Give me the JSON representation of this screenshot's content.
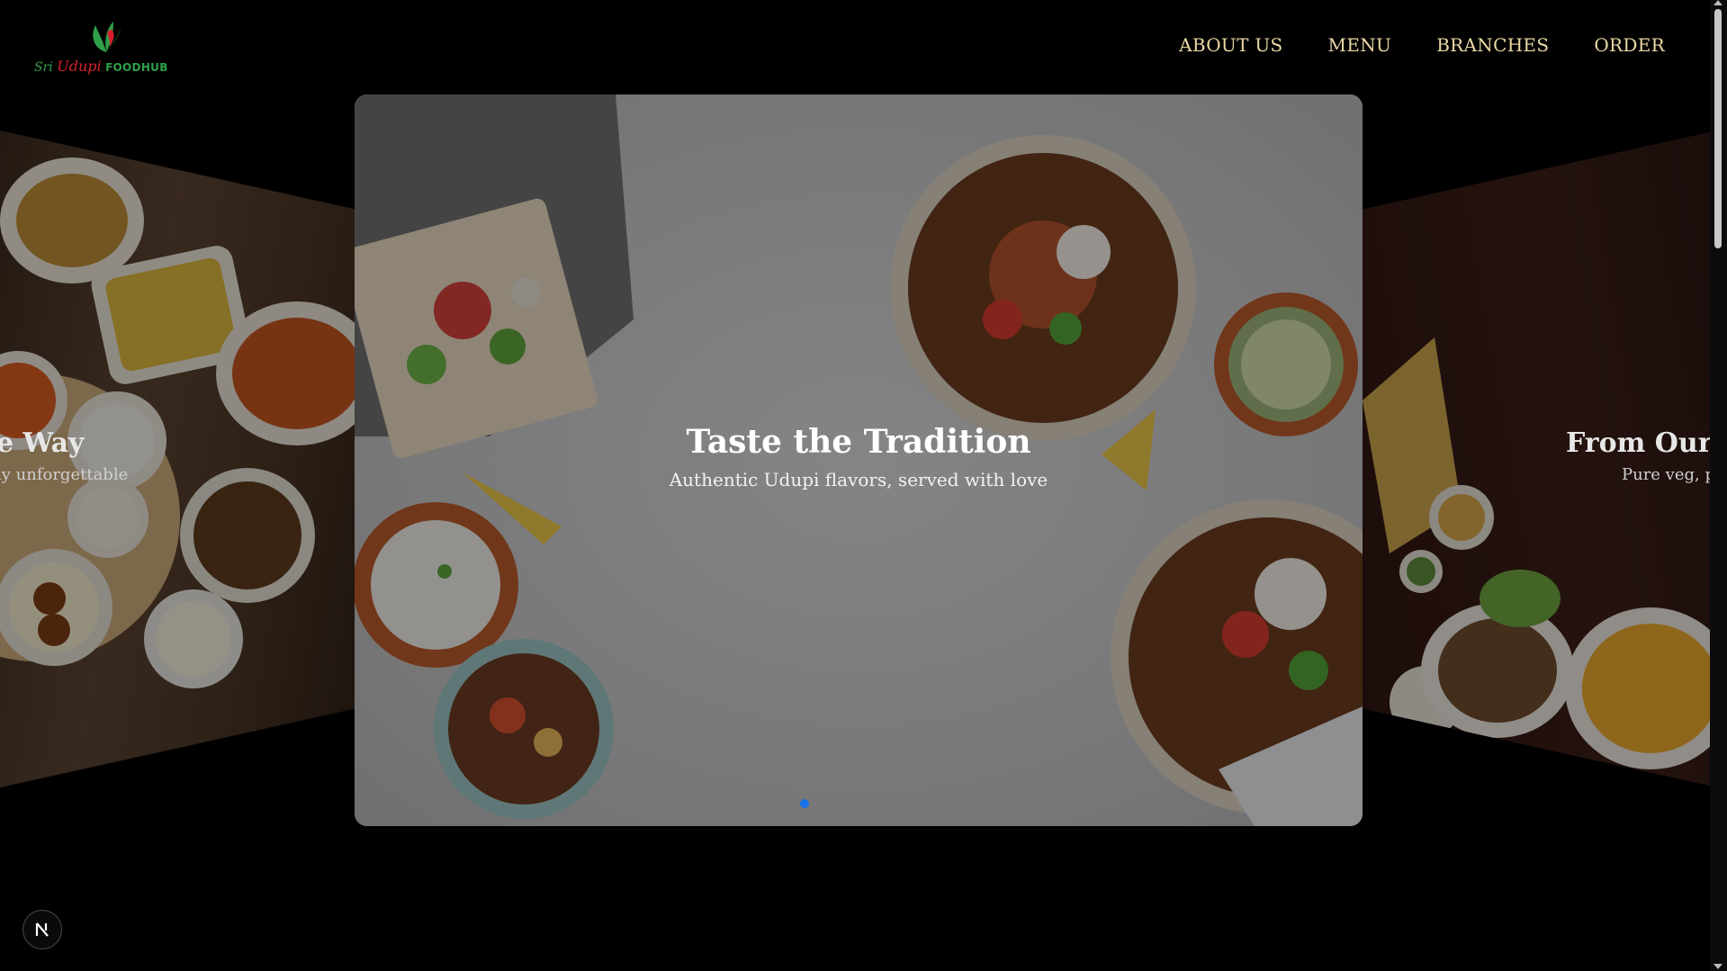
{
  "brand": {
    "logo_sri": "Sri",
    "logo_udupi": "Udupi",
    "logo_foodhub": "FOODHUB"
  },
  "nav": {
    "items": [
      {
        "label": "ABOUT US"
      },
      {
        "label": "MENU"
      },
      {
        "label": "BRANCHES"
      },
      {
        "label": "ORDER"
      }
    ]
  },
  "carousel": {
    "prev": {
      "title": "e Way",
      "subtitle": "ly unforgettable"
    },
    "current": {
      "title": "Taste the Tradition",
      "subtitle": "Authentic Udupi flavors, served with love"
    },
    "next": {
      "title": "From Our K",
      "subtitle": "Pure veg, pu"
    },
    "dot_count": 7,
    "active_index": 0
  },
  "badge": {
    "letter": "N"
  },
  "colors": {
    "nav_text": "#ead9a4",
    "brand_green": "#2fa04a",
    "brand_red": "#d8202c",
    "dot_active": "#1a73e8",
    "background": "#000000"
  }
}
